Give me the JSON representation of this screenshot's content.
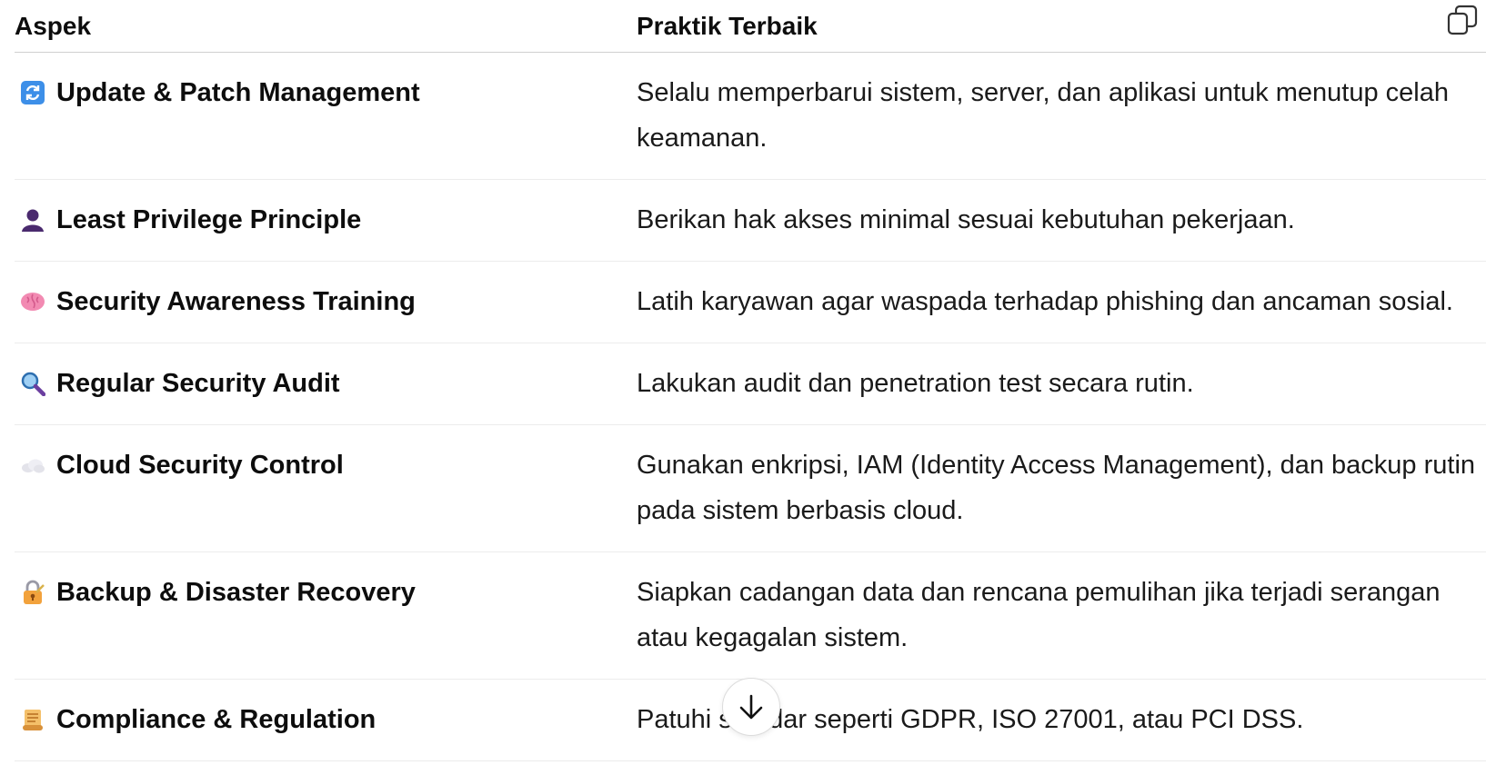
{
  "table": {
    "headers": {
      "aspect": "Aspek",
      "practice": "Praktik Terbaik"
    },
    "rows": [
      {
        "icon": "arrows-refresh-icon",
        "aspect": "Update & Patch Management",
        "practice": "Selalu memperbarui sistem, server, dan aplikasi untuk menutup celah keamanan."
      },
      {
        "icon": "person-silhouette-icon",
        "aspect": "Least Privilege Principle",
        "practice": "Berikan hak akses minimal sesuai kebutuhan pekerjaan."
      },
      {
        "icon": "brain-icon",
        "aspect": "Security Awareness Training",
        "practice": "Latih karyawan agar waspada terhadap phishing dan ancaman sosial."
      },
      {
        "icon": "magnifying-glass-icon",
        "aspect": "Regular Security Audit",
        "practice": "Lakukan audit dan penetration test secara rutin."
      },
      {
        "icon": "cloud-icon",
        "aspect": "Cloud Security Control",
        "practice": "Gunakan enkripsi, IAM (Identity Access Management), dan backup rutin pada sistem berbasis cloud."
      },
      {
        "icon": "lock-key-icon",
        "aspect": "Backup & Disaster Recovery",
        "practice": "Siapkan cadangan data dan rencana pemulihan jika terjadi serangan atau kegagalan sistem."
      },
      {
        "icon": "scroll-icon",
        "aspect": "Compliance & Regulation",
        "practice": "Patuhi standar seperti GDPR, ISO 27001, atau PCI DSS."
      }
    ]
  },
  "controls": {
    "copy_icon": "copy-icon",
    "scroll_icon": "arrow-down-icon"
  }
}
